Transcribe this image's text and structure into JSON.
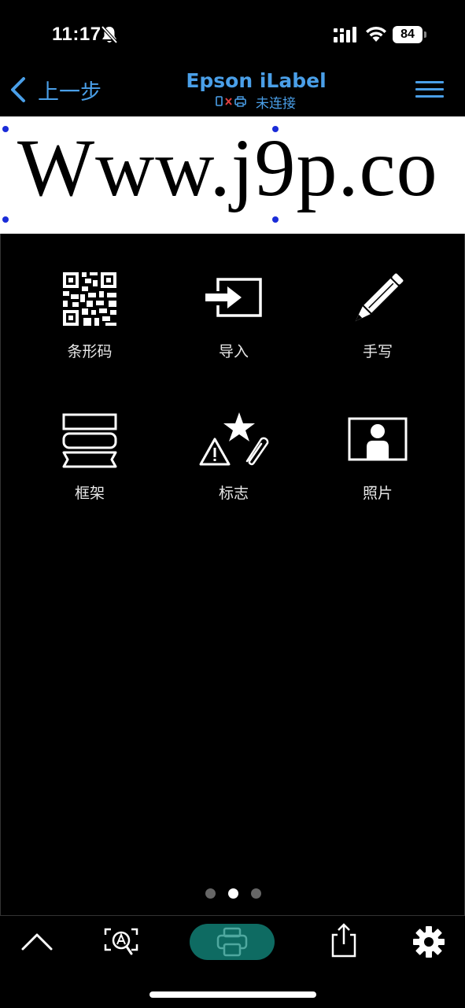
{
  "status_bar": {
    "time": "11:17",
    "battery_level": "84"
  },
  "nav": {
    "back_label": "上一步",
    "app_title": "Epson iLabel",
    "connection_status": "未连接"
  },
  "label": {
    "text": "Www.j9p.co"
  },
  "tools": [
    {
      "label": "条形码",
      "icon": "qr-code-icon"
    },
    {
      "label": "导入",
      "icon": "import-icon"
    },
    {
      "label": "手写",
      "icon": "pencil-icon"
    },
    {
      "label": "框架",
      "icon": "frame-icon"
    },
    {
      "label": "标志",
      "icon": "symbol-icon"
    },
    {
      "label": "照片",
      "icon": "photo-icon"
    }
  ],
  "pagination": {
    "total": 3,
    "current": 2
  },
  "colors": {
    "accent": "#4a9fe8",
    "print_button": "#0e6b62",
    "background": "#000000"
  }
}
